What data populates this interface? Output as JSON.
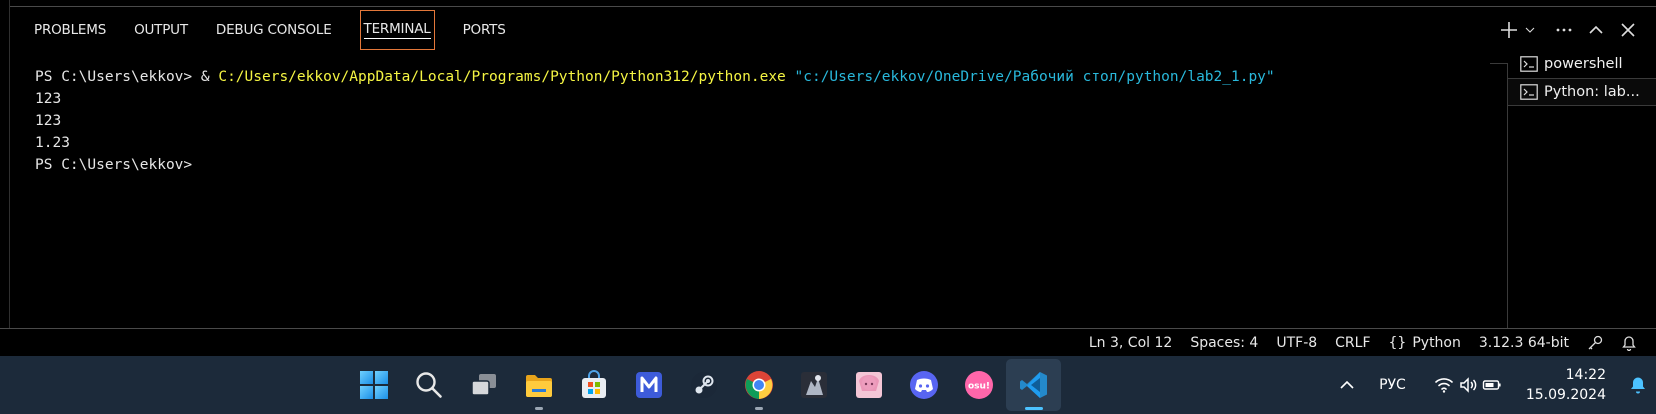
{
  "panel": {
    "tabs": [
      {
        "label": "PROBLEMS"
      },
      {
        "label": "OUTPUT"
      },
      {
        "label": "DEBUG CONSOLE"
      },
      {
        "label": "TERMINAL",
        "active": true
      },
      {
        "label": "PORTS"
      }
    ],
    "actions": [
      "plus-icon",
      "chevron-down-icon",
      "more-icon",
      "maximize-panel-icon",
      "close-icon"
    ]
  },
  "terminal": {
    "prompt": "PS C:\\Users\\ekkov> ",
    "command_op": "& ",
    "command_exe": "C:/Users/ekkov/AppData/Local/Programs/Python/Python312/python.exe",
    "command_arg": " \"c:/Users/ekkov/OneDrive/Рабочий стол/python/lab2_1.py\"",
    "output": [
      "123",
      "123",
      "1.23"
    ],
    "final_prompt": "PS C:\\Users\\ekkov>"
  },
  "terminal_list": [
    {
      "label": "powershell",
      "icon": "terminal-icon"
    },
    {
      "label": "Python: lab...",
      "icon": "terminal-icon",
      "active": true
    }
  ],
  "status_bar": {
    "position": "Ln 3, Col 12",
    "spaces": "Spaces: 4",
    "encoding": "UTF-8",
    "eol": "CRLF",
    "language_braces": "{}",
    "language": "Python",
    "interpreter": "3.12.3 64-bit",
    "icons": [
      "accounts-icon",
      "bell-icon"
    ]
  },
  "taskbar": {
    "apps": [
      "windows-start-icon",
      "search-icon",
      "task-view-icon",
      "file-explorer-icon",
      "microsoft-store-icon",
      "app-m-icon",
      "steam-icon",
      "chrome-icon",
      "game-icon",
      "anime-app-icon",
      "discord-icon",
      "osu-icon",
      "vscode-icon"
    ],
    "tray": {
      "overflow": "chevron-up-icon",
      "language": "РУС",
      "icons": [
        "wifi-icon",
        "volume-icon",
        "battery-icon"
      ],
      "time": "14:22",
      "date": "15.09.2024",
      "notifications": "bell-icon"
    }
  },
  "colors": {
    "background": "#000000",
    "tab_active_border": "#e4783a",
    "terminal_yellow": "#f5f543",
    "terminal_cyan": "#29b8db",
    "taskbar": "#1c2a3a",
    "accent_blue": "#4cc2ff"
  }
}
